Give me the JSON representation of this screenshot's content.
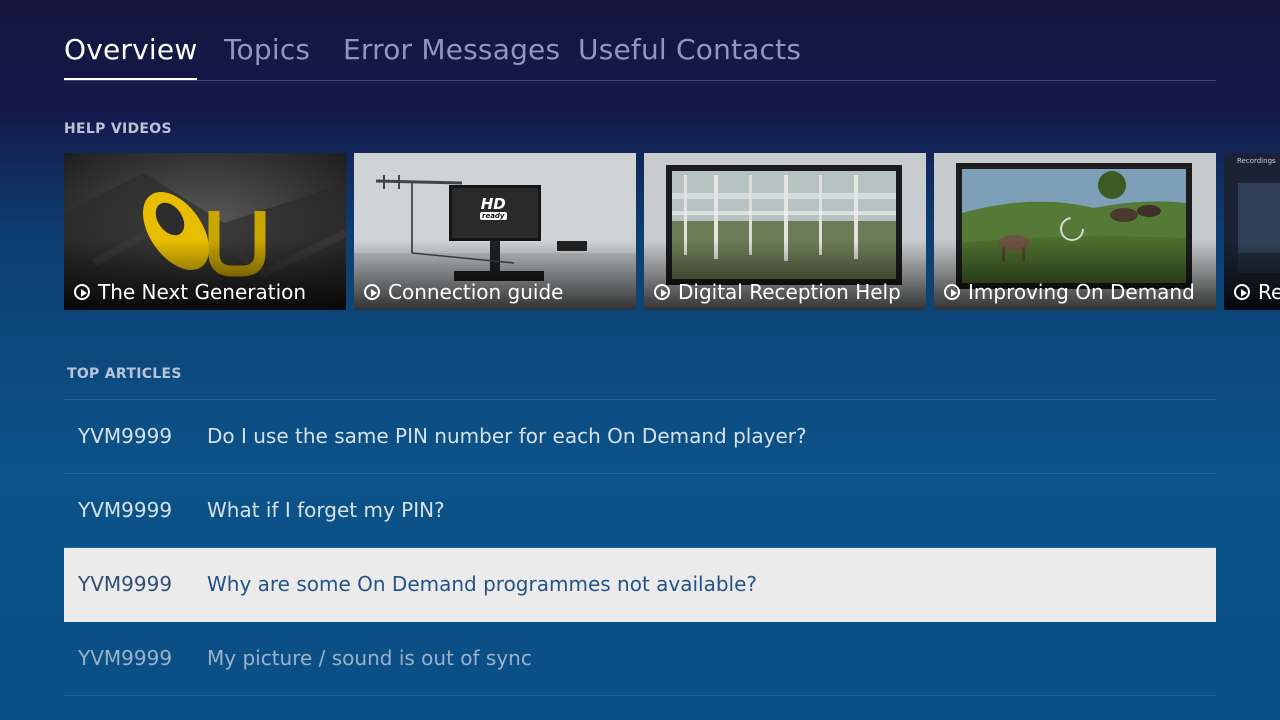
{
  "tabs": [
    {
      "label": "Overview",
      "active": true
    },
    {
      "label": "Topics",
      "active": false
    },
    {
      "label": "Error Messages",
      "active": false
    },
    {
      "label": "Useful Contacts",
      "active": false
    }
  ],
  "help_videos": {
    "heading": "HELP VIDEOS",
    "items": [
      {
        "title": "The Next Generation",
        "icon": "play-icon",
        "thumbnail_logo": "U"
      },
      {
        "title": "Connection guide",
        "icon": "play-icon",
        "thumbnail_badge": [
          "HD",
          "ready"
        ]
      },
      {
        "title": "Digital Reception Help",
        "icon": "play-icon"
      },
      {
        "title": "Improving On Demand",
        "icon": "play-icon"
      },
      {
        "title": "Re",
        "icon": "play-icon",
        "thumbnail_header": "Recordings"
      }
    ]
  },
  "top_articles": {
    "heading": "TOP ARTICLES",
    "rows": [
      {
        "code": "YVM9999",
        "title": "Do I use the same PIN number for each On Demand player?"
      },
      {
        "code": "YVM9999",
        "title": "What if I forget my PIN?"
      },
      {
        "code": "YVM9999",
        "title": "Why are some On Demand programmes not available?",
        "selected": true
      },
      {
        "code": "YVM9999",
        "title": "My picture / sound is out of sync"
      }
    ]
  },
  "colors": {
    "accent_yellow": "#f2c200",
    "selected_row": "#ebebeb",
    "selected_text": "#24538a"
  }
}
